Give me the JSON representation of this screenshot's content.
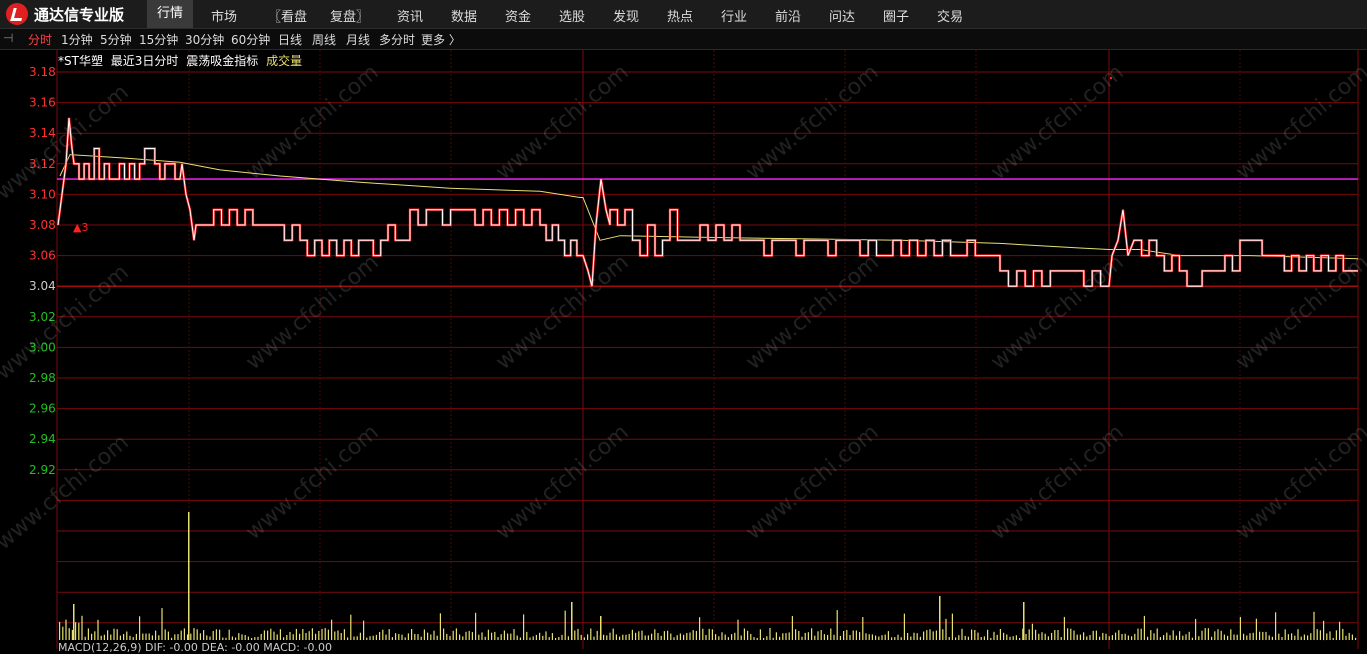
{
  "app": {
    "title": "通达信专业版"
  },
  "menu": [
    {
      "label": "行情",
      "active": true
    },
    {
      "label": "市场"
    },
    {
      "label": "〖看盘"
    },
    {
      "label": "复盘〗"
    },
    {
      "label": "资讯"
    },
    {
      "label": "数据"
    },
    {
      "label": "资金"
    },
    {
      "label": "选股"
    },
    {
      "label": "发现"
    },
    {
      "label": "热点"
    },
    {
      "label": "行业"
    },
    {
      "label": "前沿"
    },
    {
      "label": "问达"
    },
    {
      "label": "圈子"
    },
    {
      "label": "交易"
    }
  ],
  "periods": [
    {
      "label": "分时",
      "active": true
    },
    {
      "label": "1分钟"
    },
    {
      "label": "5分钟"
    },
    {
      "label": "15分钟"
    },
    {
      "label": "30分钟"
    },
    {
      "label": "60分钟"
    },
    {
      "label": "日线"
    },
    {
      "label": "周线"
    },
    {
      "label": "月线"
    },
    {
      "label": "多分时"
    },
    {
      "label": "更多 〉"
    }
  ],
  "legend": {
    "stock": "*ST华塑",
    "range": "最近3日分时",
    "indicator": "震荡吸金指标",
    "volume": "成交量"
  },
  "yaxis": {
    "labels": [
      "3.18",
      "3.16",
      "3.14",
      "3.12",
      "3.10",
      "3.08",
      "3.06",
      "3.04",
      "3.02",
      "3.00",
      "2.98",
      "2.96",
      "2.94",
      "2.92"
    ],
    "prev_close": 3.04
  },
  "markers": {
    "marker_label": "3"
  },
  "watermark": "www.cfchi.com",
  "bottom_text": "MACD(12,26,9) DIF: -0.00 DEA: -0.00 MACD: -0.00",
  "colors": {
    "up": "#ff3232",
    "down": "#20c020",
    "grid": "#7a0a0a",
    "magenta_line": "#e020e0",
    "avg_line": "#e8e070",
    "volume": "#e8e070"
  }
}
